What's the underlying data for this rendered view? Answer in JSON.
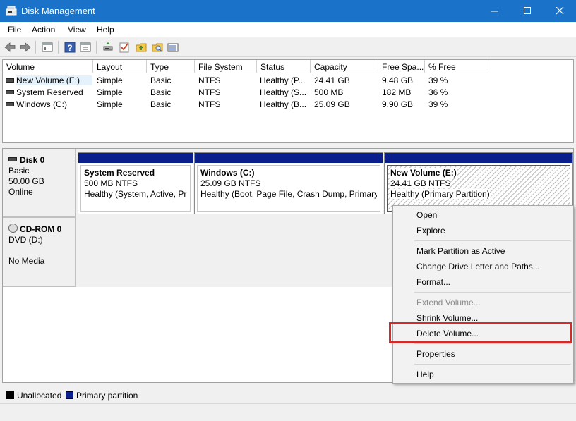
{
  "window": {
    "title": "Disk Management"
  },
  "menu": [
    "File",
    "Action",
    "View",
    "Help"
  ],
  "toolbar_icons": [
    "back-arrow-icon",
    "forward-arrow-icon",
    "console-tree-icon",
    "help-icon",
    "properties-icon",
    "rescan-disks-icon",
    "check-icon",
    "folder-up-icon",
    "folder-search-icon",
    "view-list-icon"
  ],
  "volume_list": {
    "columns": [
      "Volume",
      "Layout",
      "Type",
      "File System",
      "Status",
      "Capacity",
      "Free Spa...",
      "% Free"
    ],
    "rows": [
      {
        "volume": "New Volume (E:)",
        "layout": "Simple",
        "type": "Basic",
        "fs": "NTFS",
        "status": "Healthy (P...",
        "capacity": "24.41 GB",
        "free": "9.48 GB",
        "pct": "39 %"
      },
      {
        "volume": "System Reserved",
        "layout": "Simple",
        "type": "Basic",
        "fs": "NTFS",
        "status": "Healthy (S...",
        "capacity": "500 MB",
        "free": "182 MB",
        "pct": "36 %"
      },
      {
        "volume": "Windows (C:)",
        "layout": "Simple",
        "type": "Basic",
        "fs": "NTFS",
        "status": "Healthy (B...",
        "capacity": "25.09 GB",
        "free": "9.90 GB",
        "pct": "39 %"
      }
    ]
  },
  "disks": [
    {
      "name": "Disk 0",
      "kind": "Basic",
      "size": "50.00 GB",
      "state": "Online",
      "partitions": [
        {
          "name": "System Reserved",
          "size": "500 MB NTFS",
          "status": "Healthy (System, Active, Primary Partition)"
        },
        {
          "name": "Windows  (C:)",
          "size": "25.09 GB NTFS",
          "status": "Healthy (Boot, Page File, Crash Dump, Primary Partition)"
        },
        {
          "name": "New Volume  (E:)",
          "size": "24.41 GB NTFS",
          "status": "Healthy (Primary Partition)"
        }
      ]
    },
    {
      "name": "CD-ROM 0",
      "kind": "DVD (D:)",
      "size": "",
      "state": "No Media"
    }
  ],
  "legend": [
    {
      "label": "Unallocated",
      "color": "#000000"
    },
    {
      "label": "Primary partition",
      "color": "#0a1e8c"
    }
  ],
  "context_menu": {
    "items": [
      {
        "label": "Open",
        "enabled": true
      },
      {
        "label": "Explore",
        "enabled": true
      },
      {
        "label": "Mark Partition as Active",
        "enabled": true
      },
      {
        "label": "Change Drive Letter and Paths...",
        "enabled": true
      },
      {
        "label": "Format...",
        "enabled": true
      },
      {
        "label": "Extend Volume...",
        "enabled": false
      },
      {
        "label": "Shrink Volume...",
        "enabled": true
      },
      {
        "label": "Delete Volume...",
        "enabled": true
      },
      {
        "label": "Properties",
        "enabled": true
      },
      {
        "label": "Help",
        "enabled": true
      }
    ],
    "highlighted": "Delete Volume...",
    "highlight_color": "#d42a2a"
  }
}
